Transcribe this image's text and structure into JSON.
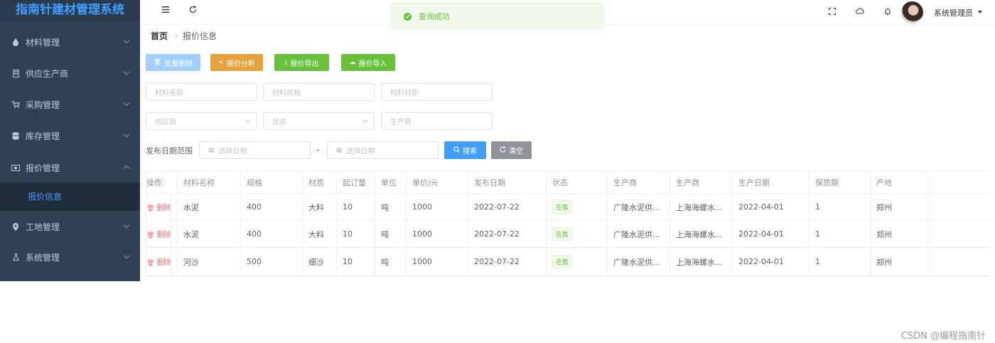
{
  "app_title": "指南针建材管理系统",
  "sidebar": {
    "items": [
      {
        "label": "材料管理",
        "icon": "droplet-icon"
      },
      {
        "label": "供应生产商",
        "icon": "building-icon"
      },
      {
        "label": "采购管理",
        "icon": "cart-icon"
      },
      {
        "label": "库存管理",
        "icon": "database-icon"
      },
      {
        "label": "报价管理",
        "icon": "money-icon",
        "expanded": true
      },
      {
        "label": "工地管理",
        "icon": "location-icon"
      },
      {
        "label": "系统管理",
        "icon": "flask-icon"
      }
    ],
    "active_sub": "报价信息"
  },
  "header": {
    "user": "系统管理员",
    "toast": "查询成功"
  },
  "breadcrumb": {
    "home": "首页",
    "current": "报价信息"
  },
  "toolbar": {
    "batch_delete": "批量删除",
    "analyze": "报价分析",
    "export": "报价导出",
    "import": "报价导入"
  },
  "filters": {
    "material_name": "材料名称",
    "material_spec": "材料规格",
    "material_quality": "材料材质",
    "supplier": "供应商",
    "status": "状态",
    "manufacturer": "生产商",
    "date_range_label": "发布日期范围",
    "date_start": "选择日期",
    "date_dash": "-",
    "date_end": "选择日期",
    "search": "搜索",
    "clear": "清空"
  },
  "table": {
    "headers": [
      "材料名称",
      "规格",
      "材质",
      "起订量",
      "单位",
      "单价/元",
      "发布日期",
      "状态",
      "生产商",
      "生产商",
      "生产日期",
      "保质期",
      "产地",
      "操作"
    ],
    "rows": [
      [
        "水泥",
        "400",
        "大料",
        "10",
        "吨",
        "1000",
        "2022-07-22",
        "在售",
        "广隆水泥供...",
        "上海海螺水...",
        "2022-04-01",
        "1",
        "郑州",
        "删除"
      ],
      [
        "水泥",
        "400",
        "大料",
        "10",
        "吨",
        "1000",
        "2022-07-22",
        "在售",
        "广隆水泥供...",
        "上海海螺水...",
        "2022-04-01",
        "1",
        "郑州",
        "删除"
      ],
      [
        "河沙",
        "500",
        "细沙",
        "10",
        "吨",
        "1000",
        "2022-07-22",
        "在售",
        "广隆水泥供...",
        "上海海螺水...",
        "2022-04-01",
        "1",
        "郑州",
        "删除"
      ]
    ]
  },
  "watermark": "CSDN @编程指南针",
  "colors": {
    "primary": "#409eff",
    "success": "#67c23a",
    "warning": "#e6a23c",
    "danger": "#f56c6c",
    "sidebar": "#304156"
  }
}
